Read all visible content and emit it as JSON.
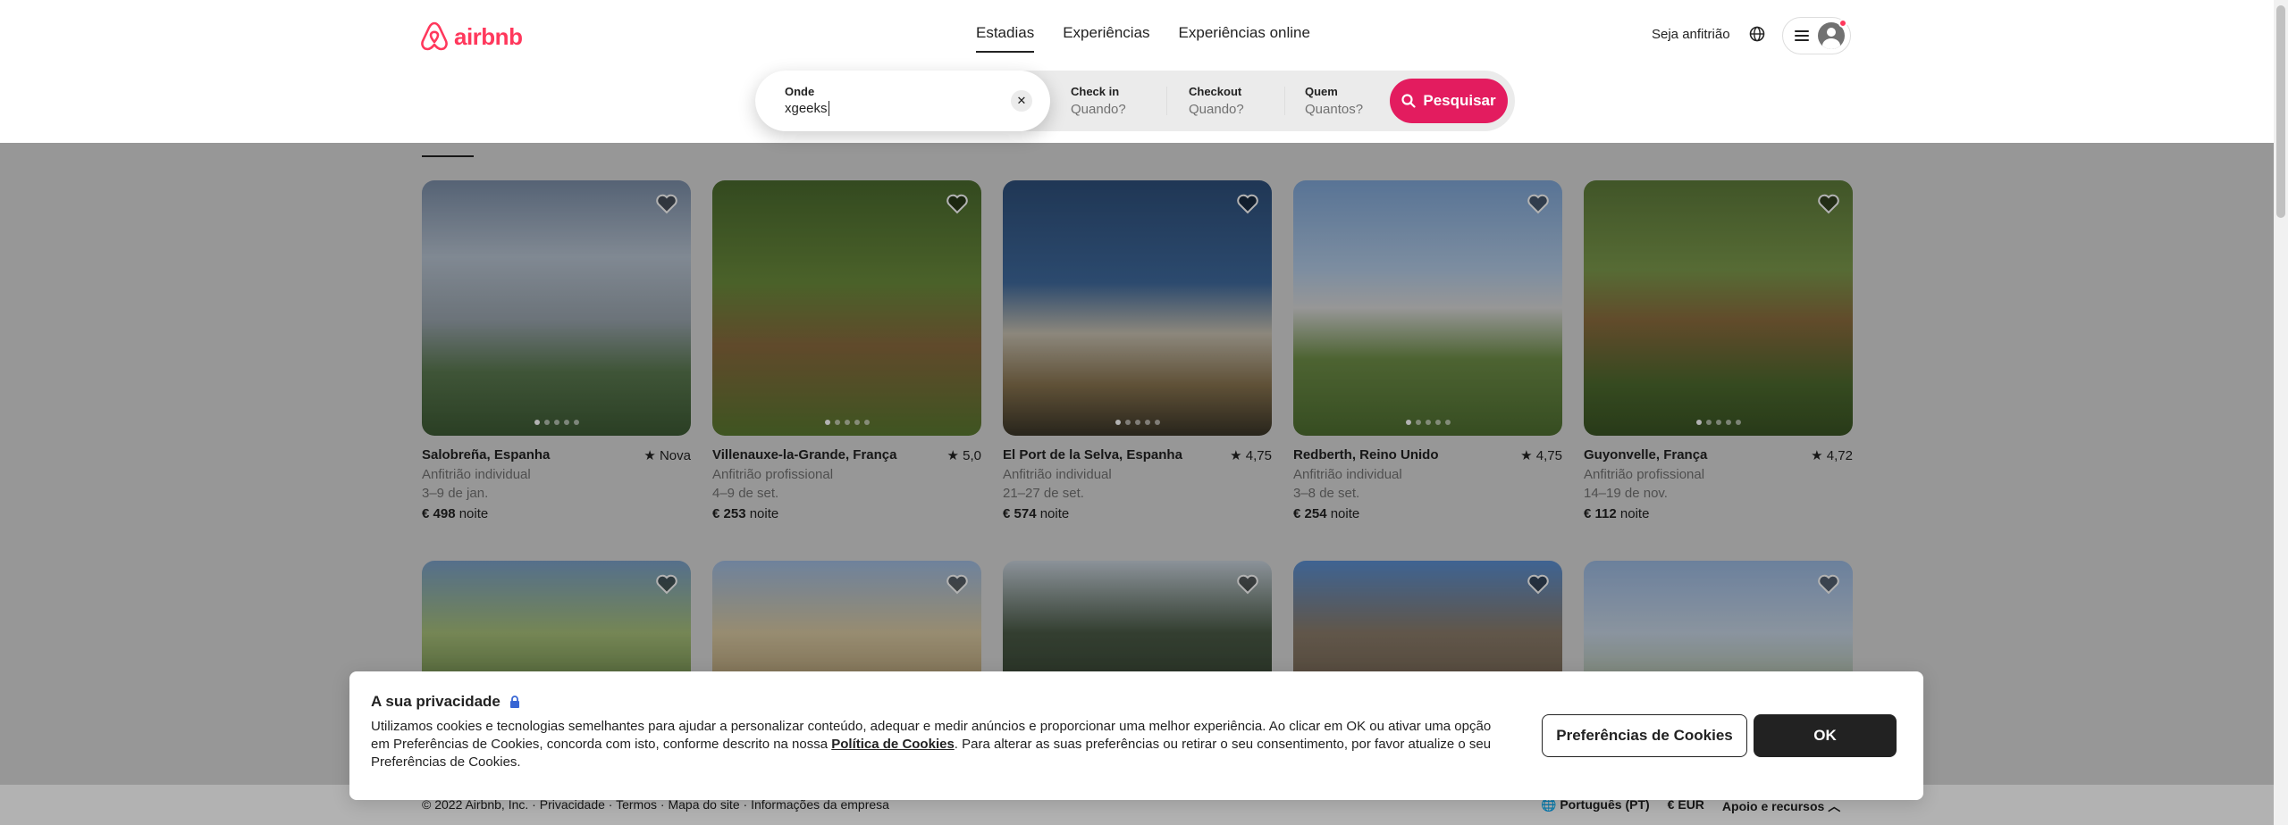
{
  "brand": {
    "name": "airbnb",
    "color": "#ff385c"
  },
  "nav": {
    "tabs": [
      {
        "label": "Estadias",
        "active": true
      },
      {
        "label": "Experiências",
        "active": false
      },
      {
        "label": "Experiências online",
        "active": false
      }
    ],
    "host_link": "Seja anfitrião",
    "globe_icon": "globe-icon",
    "menu_icon": "hamburger-icon",
    "avatar_icon": "user-avatar-icon"
  },
  "search": {
    "where": {
      "label": "Onde",
      "value": "xgeeks"
    },
    "checkin": {
      "label": "Check in",
      "placeholder": "Quando?"
    },
    "checkout": {
      "label": "Checkout",
      "placeholder": "Quando?"
    },
    "who": {
      "label": "Quem",
      "placeholder": "Quantos?"
    },
    "button_label": "Pesquisar",
    "button_color": "#e31c5f"
  },
  "listings": [
    {
      "title": "Salobreña, Espanha",
      "rating": "Nova",
      "host": "Anfitrião individual",
      "dates": "3–9 de jan.",
      "price": "€ 498",
      "price_unit": " noite"
    },
    {
      "title": "Villenauxe-la-Grande, França",
      "rating": "5,0",
      "host": "Anfitrião profissional",
      "dates": "4–9 de set.",
      "price": "€ 253",
      "price_unit": " noite"
    },
    {
      "title": "El Port de la Selva, Espanha",
      "rating": "4,75",
      "host": "Anfitrião individual",
      "dates": "21–27 de set.",
      "price": "€ 574",
      "price_unit": " noite"
    },
    {
      "title": "Redberth, Reino Unido",
      "rating": "4,75",
      "host": "Anfitrião individual",
      "dates": "3–8 de set.",
      "price": "€ 254",
      "price_unit": " noite"
    },
    {
      "title": "Guyonvelle, França",
      "rating": "4,72",
      "host": "Anfitrião profissional",
      "dates": "14–19 de nov.",
      "price": "€ 112",
      "price_unit": " noite"
    }
  ],
  "footer": {
    "copyright": "© 2022 Airbnb, Inc.",
    "links": [
      "Privacidade",
      "Termos",
      "Mapa do site",
      "Informações da empresa"
    ],
    "language": "Português (PT)",
    "currency_symbol": "€",
    "currency": "EUR",
    "support": "Apoio e recursos"
  },
  "cookie": {
    "title": "A sua privacidade",
    "text_before_link": "Utilizamos cookies e tecnologias semelhantes para ajudar a personalizar conteúdo, adequar e medir anúncios e proporcionar uma melhor experiência. Ao clicar em OK ou ativar uma opção em Preferências de Cookies, concorda com isto, conforme descrito na nossa ",
    "link_text": "Política de Cookies",
    "text_after_link": ". Para alterar as suas preferências ou retirar o seu consentimento, por favor atualize o seu Preferências de Cookies.",
    "preferences_button": "Preferências de Cookies",
    "ok_button": "OK"
  }
}
